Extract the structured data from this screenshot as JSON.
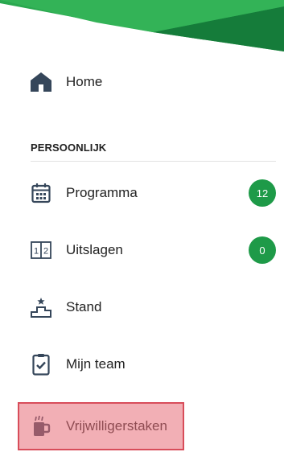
{
  "colors": {
    "brand_green": "#1e9a48",
    "banner_light_green": "#2faf52",
    "banner_dark_green": "#137a38",
    "icon_navy": "#35465a",
    "highlight": "#d84d5a"
  },
  "nav": {
    "home": {
      "label": "Home",
      "icon": "home-icon"
    },
    "section_header": "PERSOONLIJK",
    "items": [
      {
        "label": "Programma",
        "icon": "calendar-icon",
        "badge": "12"
      },
      {
        "label": "Uitslagen",
        "icon": "scoreboard-icon",
        "badge": "0"
      },
      {
        "label": "Stand",
        "icon": "podium-icon"
      },
      {
        "label": "Mijn team",
        "icon": "clipboard-check-icon"
      },
      {
        "label": "Vrijwilligerstaken",
        "icon": "beer-mug-icon",
        "highlighted": true
      }
    ]
  }
}
